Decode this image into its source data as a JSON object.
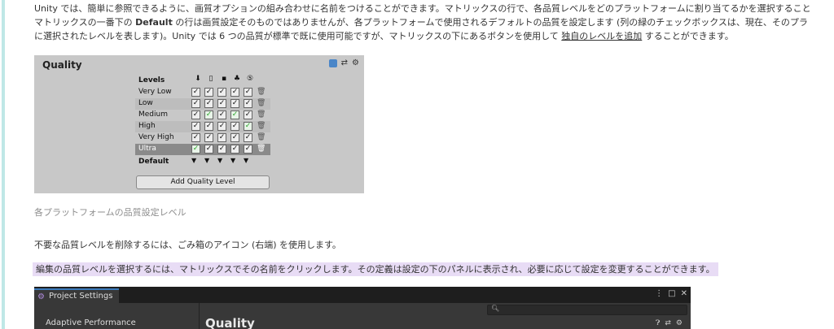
{
  "intro": {
    "line1": "Unity では、簡単に参照できるように、画質オプションの組み合わせに名前をつけることができます。マトリックスの行で、各品質レベルをどのプラットフォームに割り当てるかを選択すること",
    "line2_pre": "マトリックスの一番下の ",
    "line2_bold": "Default",
    "line2_post": " の行は画質設定そのものではありませんが、各プラットフォームで使用されるデフォルトの品質を設定します (列の緑のチェックボックスは、現在、そのプラ",
    "line3_pre": "に選択されたレベルを表します)。Unity では 6 つの品質が標準で既に使用可能ですが、マトリックスの下にあるボタンを使用して ",
    "line3_link": "独自のレベルを追加",
    "line3_post": " することができます。"
  },
  "quality_panel": {
    "title": "Quality",
    "levels_header": "Levels",
    "platform_icons": [
      "download-icon",
      "mobile-icon",
      "tv-icon",
      "android-icon",
      "html5-icon"
    ],
    "rows": [
      {
        "label": "Very Low",
        "checks": [
          "on",
          "on",
          "on",
          "on",
          "on"
        ]
      },
      {
        "label": "Low",
        "checks": [
          "on",
          "on",
          "on",
          "on",
          "on"
        ]
      },
      {
        "label": "Medium",
        "checks": [
          "on",
          "green",
          "on",
          "green",
          "on"
        ]
      },
      {
        "label": "High",
        "checks": [
          "on",
          "on",
          "on",
          "on",
          "green"
        ]
      },
      {
        "label": "Very High",
        "checks": [
          "on",
          "on",
          "on",
          "on",
          "on"
        ]
      },
      {
        "label": "Ultra",
        "checks": [
          "green",
          "on",
          "on",
          "on",
          "on"
        ]
      }
    ],
    "default_label": "Default",
    "add_button": "Add Quality Level"
  },
  "caption": "各プラットフォームの品質設定レベル",
  "para_delete": "不要な品質レベルを削除するには、ごみ箱のアイコン (右端) を使用します。",
  "para_edit": "編集の品質レベルを選択するには、マトリックスでその名前をクリックします。その定義は設定の下のパネルに表示され、必要に応じて設定を変更することができます。",
  "project_settings": {
    "tab_label": "Project Settings",
    "sidebar_first": "Adaptive Performance",
    "main_title": "Quality"
  }
}
